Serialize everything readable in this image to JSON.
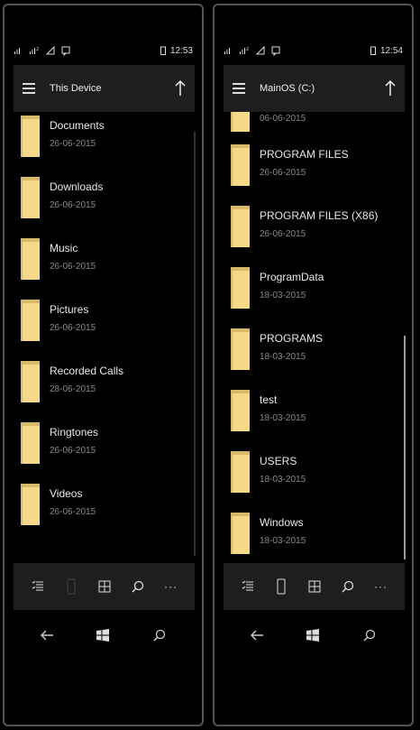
{
  "screens": [
    {
      "time": "12:53",
      "title": "This Device",
      "items": [
        {
          "name": "Documents",
          "date": "26-06-2015"
        },
        {
          "name": "Downloads",
          "date": "26-06-2015"
        },
        {
          "name": "Music",
          "date": "26-06-2015"
        },
        {
          "name": "Pictures",
          "date": "26-06-2015"
        },
        {
          "name": "Recorded Calls",
          "date": "28-06-2015"
        },
        {
          "name": "Ringtones",
          "date": "26-06-2015"
        },
        {
          "name": "Videos",
          "date": "26-06-2015"
        }
      ],
      "partial_top_date": ""
    },
    {
      "time": "12:54",
      "title": "MainOS (C:)",
      "partial_top_date": "06-06-2015",
      "items": [
        {
          "name": "PROGRAM FILES",
          "date": "26-06-2015"
        },
        {
          "name": "PROGRAM FILES (X86)",
          "date": "26-06-2015"
        },
        {
          "name": "ProgramData",
          "date": "18-03-2015"
        },
        {
          "name": "PROGRAMS",
          "date": "18-03-2015"
        },
        {
          "name": "test",
          "date": "18-03-2015"
        },
        {
          "name": "USERS",
          "date": "18-03-2015"
        },
        {
          "name": "Windows",
          "date": "18-03-2015"
        }
      ]
    }
  ],
  "appbar": {
    "more_label": "···"
  },
  "icons": {
    "folder": "folder-icon",
    "menu": "hamburger-icon",
    "up": "up-arrow-icon",
    "select": "select-list-icon",
    "device": "phone-device-icon",
    "grid": "grid-view-icon",
    "search": "search-icon",
    "back": "back-arrow-icon",
    "start": "windows-logo-icon"
  },
  "colors": {
    "folder": "#f5d98a",
    "bar": "#1e1e1e",
    "background": "#000000"
  }
}
